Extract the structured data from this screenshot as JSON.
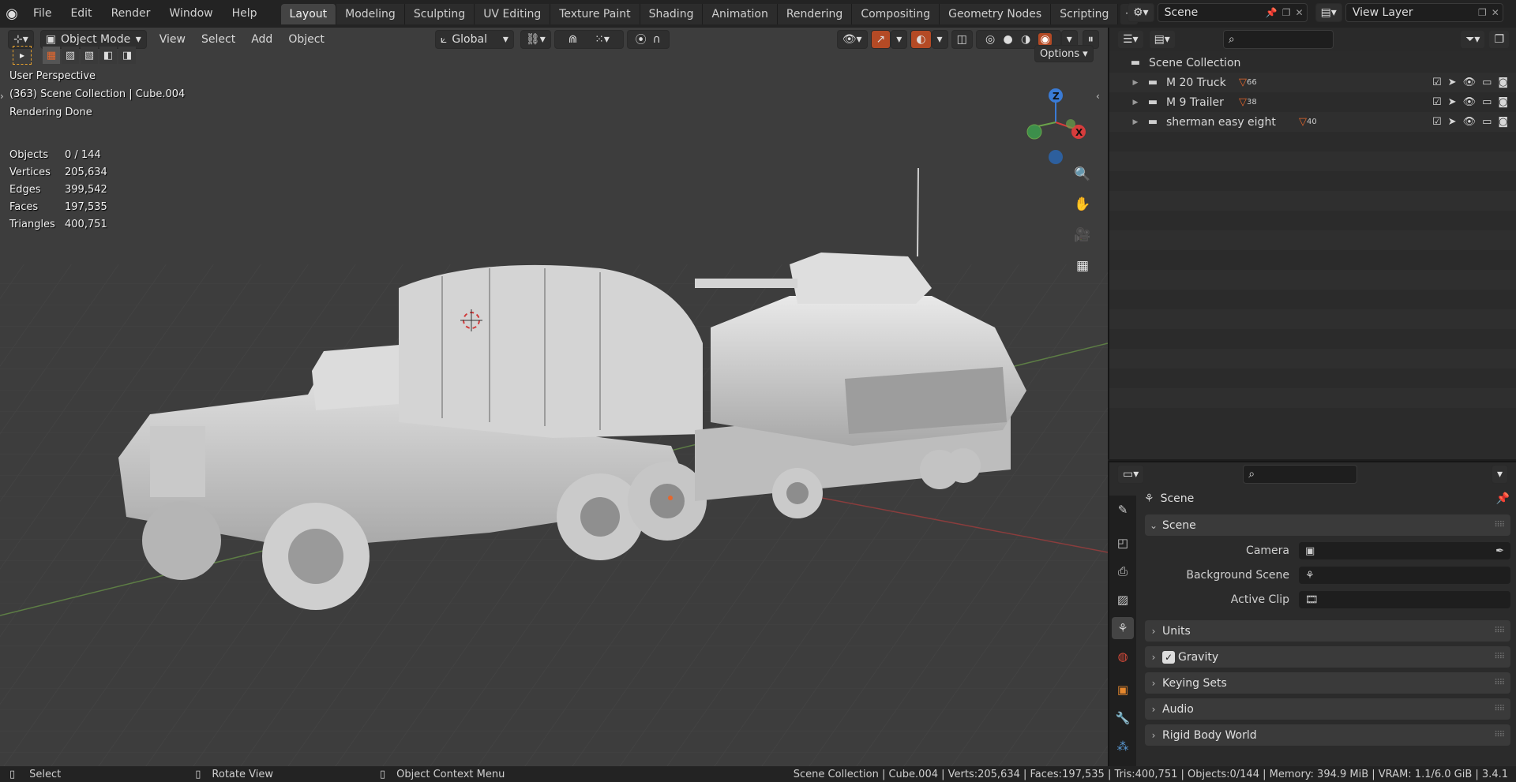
{
  "menu": {
    "file": "File",
    "edit": "Edit",
    "render": "Render",
    "window": "Window",
    "help": "Help"
  },
  "workspaces": [
    "Layout",
    "Modeling",
    "Sculpting",
    "UV Editing",
    "Texture Paint",
    "Shading",
    "Animation",
    "Rendering",
    "Compositing",
    "Geometry Nodes",
    "Scripting"
  ],
  "scene_field": "Scene",
  "view_layer_field": "View Layer",
  "viewport_header": {
    "mode": "Object Mode",
    "view": "View",
    "select": "Select",
    "add": "Add",
    "object": "Object",
    "orientation": "Global",
    "options": "Options"
  },
  "overlay": {
    "perspective": "User Perspective",
    "collection": "(363) Scene Collection | Cube.004",
    "status": "Rendering Done"
  },
  "stats": [
    {
      "k": "Objects",
      "v": "0 / 144"
    },
    {
      "k": "Vertices",
      "v": "205,634"
    },
    {
      "k": "Edges",
      "v": "399,542"
    },
    {
      "k": "Faces",
      "v": "197,535"
    },
    {
      "k": "Triangles",
      "v": "400,751"
    }
  ],
  "gizmo": {
    "z": "Z",
    "x": "X"
  },
  "outliner": {
    "root": "Scene Collection",
    "items": [
      {
        "name": "M 20 Truck",
        "count": "66"
      },
      {
        "name": "M 9 Trailer",
        "count": "38"
      },
      {
        "name": "sherman easy eight",
        "count": "40"
      }
    ]
  },
  "properties": {
    "context": "Scene",
    "panel_scene": "Scene",
    "camera_label": "Camera",
    "bgscene_label": "Background Scene",
    "clip_label": "Active Clip",
    "panels": [
      "Units",
      "Gravity",
      "Keying Sets",
      "Audio",
      "Rigid Body World"
    ]
  },
  "statusbar": {
    "select": "Select",
    "rotate": "Rotate View",
    "context": "Object Context Menu",
    "info": "Scene Collection | Cube.004 | Verts:205,634 | Faces:197,535 | Tris:400,751 | Objects:0/144 | Memory: 394.9 MiB | VRAM: 1.1/6.0 GiB | 3.4.1"
  },
  "colors": {
    "accent": "#e5672d",
    "x_axis": "#d63c3c",
    "y_axis": "#6ba34a",
    "z_axis": "#3a7bd5"
  }
}
